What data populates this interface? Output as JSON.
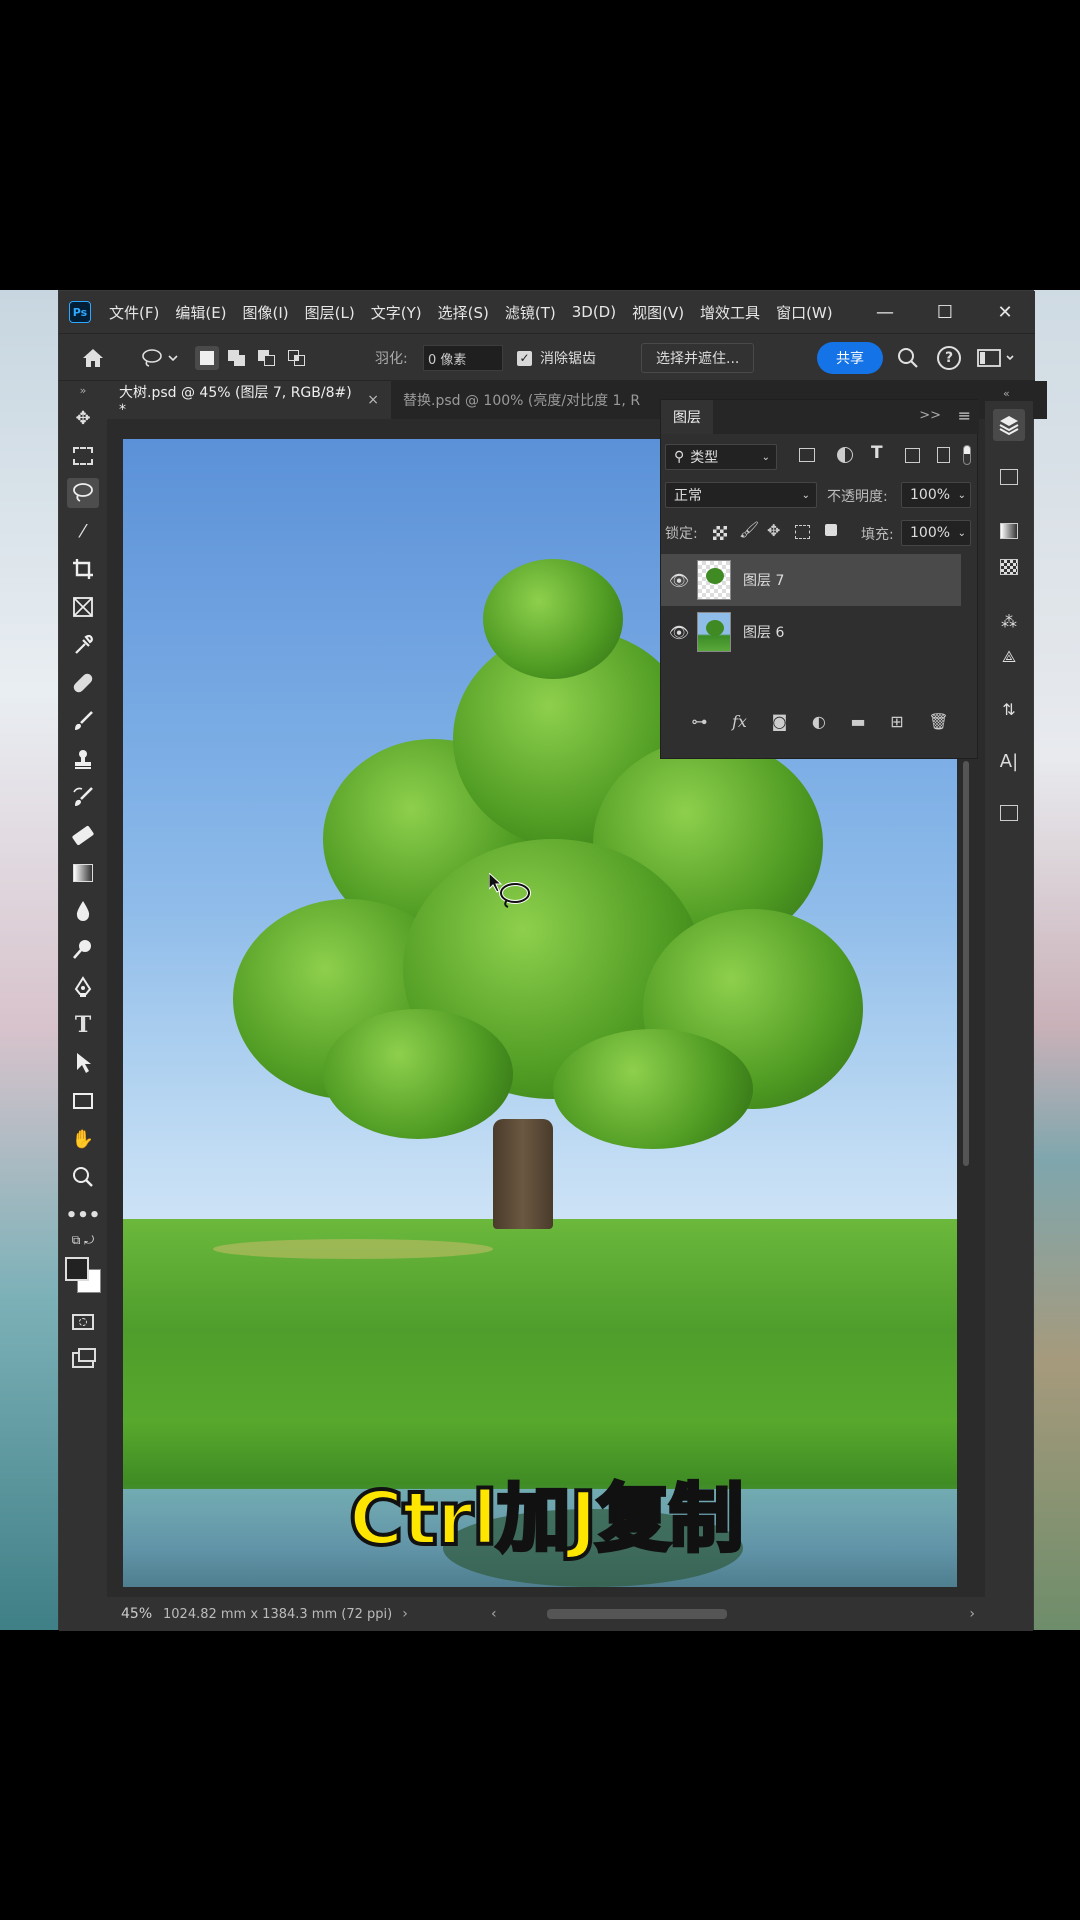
{
  "menubar": {
    "app_logo": "Ps",
    "items": [
      "文件(F)",
      "编辑(E)",
      "图像(I)",
      "图层(L)",
      "文字(Y)",
      "选择(S)",
      "滤镜(T)",
      "3D(D)",
      "视图(V)",
      "增效工具",
      "窗口(W)"
    ],
    "window_controls": [
      "—",
      "☐",
      "✕"
    ]
  },
  "options": {
    "feather_label": "羽化:",
    "feather_value": "0 像素",
    "antialias_label": "消除锯齿",
    "antialias_checked": true,
    "select_mask_label": "选择并遮住...",
    "share_label": "共享"
  },
  "tabs": [
    {
      "label": "大树.psd @ 45% (图层 7, RGB/8#) *",
      "close": "×",
      "active": true
    },
    {
      "label": "替换.psd @ 100% (亮度/对比度 1, R",
      "active": false
    }
  ],
  "layers_panel": {
    "tab_label": "图层",
    "filter_kind": "类型",
    "blend_mode": "正常",
    "opacity_label": "不透明度:",
    "opacity_value": "100%",
    "lock_label": "锁定:",
    "fill_label": "填充:",
    "fill_value": "100%",
    "layers": [
      {
        "name": "图层 7",
        "selected": true,
        "transparent": true
      },
      {
        "name": "图层 6",
        "selected": false,
        "transparent": false
      }
    ]
  },
  "status": {
    "zoom": "45%",
    "doc_info": "1024.82 mm x 1384.3 mm (72 ppi)"
  },
  "caption": "Ctrl加J复制"
}
